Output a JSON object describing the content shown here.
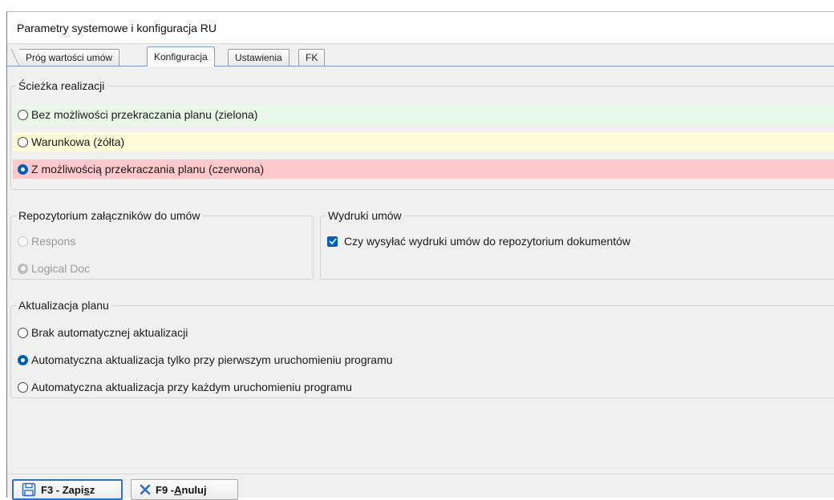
{
  "window": {
    "title": "Parametry systemowe i konfiguracja RU"
  },
  "tabs": [
    {
      "label": "Próg wartości umów",
      "active": false
    },
    {
      "label": "Konfiguracja",
      "active": true
    },
    {
      "label": "Ustawienia",
      "active": false
    },
    {
      "label": "FK",
      "active": false
    }
  ],
  "sciezka": {
    "legend": "Ścieżka realizacji",
    "options": [
      {
        "label": "Bez możliwości przekraczania planu (zielona)",
        "checked": false,
        "color": "#e9f9e7"
      },
      {
        "label": "Warunkowa (żółta)",
        "checked": false,
        "color": "#fdfbd8"
      },
      {
        "label": "Z możliwością przekraczania planu (czerwona)",
        "checked": true,
        "color": "#fec9cc"
      }
    ]
  },
  "repozytorium": {
    "legend": "Repozytorium załączników do umów",
    "options": [
      {
        "label": "Respons",
        "checked": false,
        "disabled": true
      },
      {
        "label": "Logical Doc",
        "checked": true,
        "disabled": true
      }
    ]
  },
  "wydruki": {
    "legend": "Wydruki umów",
    "checkbox_label": "Czy wysyłać wydruki umów do repozytorium dokumentów",
    "checked": true
  },
  "aktualizacja": {
    "legend": "Aktualizacja planu",
    "options": [
      {
        "label": "Brak automatycznej aktualizacji",
        "checked": false
      },
      {
        "label": "Automatyczna aktualizacja tylko przy pierwszym uruchomieniu programu",
        "checked": true
      },
      {
        "label": "Automatyczna aktualizacja przy każdym uruchomieniu programu",
        "checked": false
      }
    ]
  },
  "buttons": {
    "save_prefix": "F3 - Zapi",
    "save_underline": "s",
    "save_suffix": "z",
    "cancel_prefix": "F9 - ",
    "cancel_underline": "A",
    "cancel_suffix": "nuluj",
    "save_icon": "floppy-disk-icon",
    "cancel_icon": "close-x-icon",
    "accent": "#2f6fc4"
  }
}
